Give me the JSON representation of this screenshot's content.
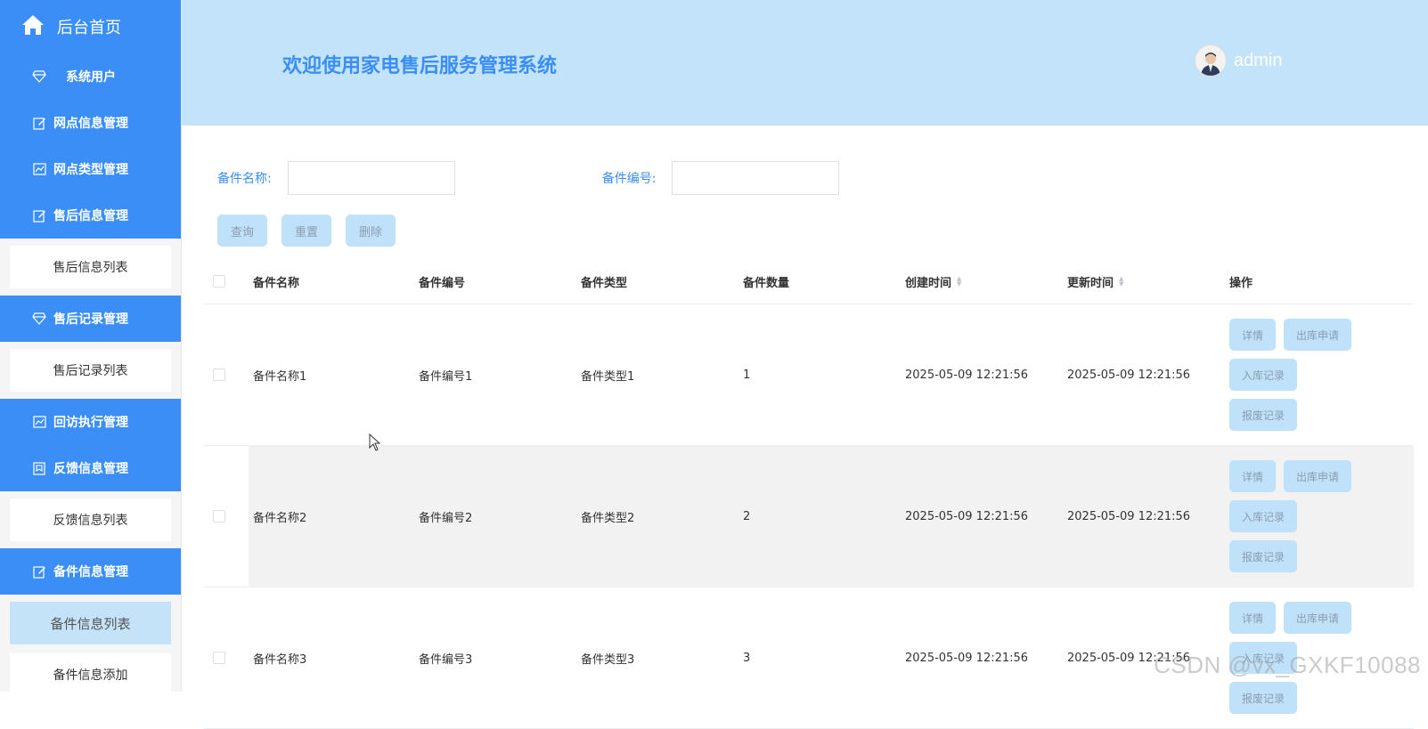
{
  "sidebar": {
    "home_label": "后台首页",
    "items": [
      {
        "label": "系统用户"
      },
      {
        "label": "网点信息管理"
      },
      {
        "label": "网点类型管理"
      },
      {
        "label": "售后信息管理"
      },
      {
        "label": "售后信息列表"
      },
      {
        "label": "售后记录管理"
      },
      {
        "label": "售后记录列表"
      },
      {
        "label": "回访执行管理"
      },
      {
        "label": "反馈信息管理"
      },
      {
        "label": "反馈信息列表"
      },
      {
        "label": "备件信息管理"
      },
      {
        "label": "备件信息列表"
      },
      {
        "label": "备件信息添加"
      }
    ]
  },
  "header": {
    "title": "欢迎使用家电售后服务管理系统",
    "username": "admin"
  },
  "search": {
    "name_label": "备件名称:",
    "code_label": "备件编号:",
    "name_value": "",
    "code_value": ""
  },
  "buttons": {
    "query": "查询",
    "reset": "重置",
    "delete": "删除"
  },
  "table": {
    "headers": [
      "备件名称",
      "备件编号",
      "备件类型",
      "备件数量",
      "创建时间",
      "更新时间",
      "操作"
    ],
    "rows": [
      {
        "name": "备件名称1",
        "code": "备件编号1",
        "type": "备件类型1",
        "qty": "1",
        "created": "2025-05-09 12:21:56",
        "updated": "2025-05-09 12:21:56"
      },
      {
        "name": "备件名称2",
        "code": "备件编号2",
        "type": "备件类型2",
        "qty": "2",
        "created": "2025-05-09 12:21:56",
        "updated": "2025-05-09 12:21:56"
      },
      {
        "name": "备件名称3",
        "code": "备件编号3",
        "type": "备件类型3",
        "qty": "3",
        "created": "2025-05-09 12:21:56",
        "updated": "2025-05-09 12:21:56"
      }
    ],
    "actions": {
      "detail": "详情",
      "outbound": "出库申请",
      "inbound": "入库记录",
      "scrap": "报废记录"
    }
  },
  "watermark": "CSDN @vx_GXKF10088",
  "colors": {
    "primary": "#3a8ef6",
    "header_bg": "#c2e3f9",
    "button_bg": "#bfe2fa"
  }
}
